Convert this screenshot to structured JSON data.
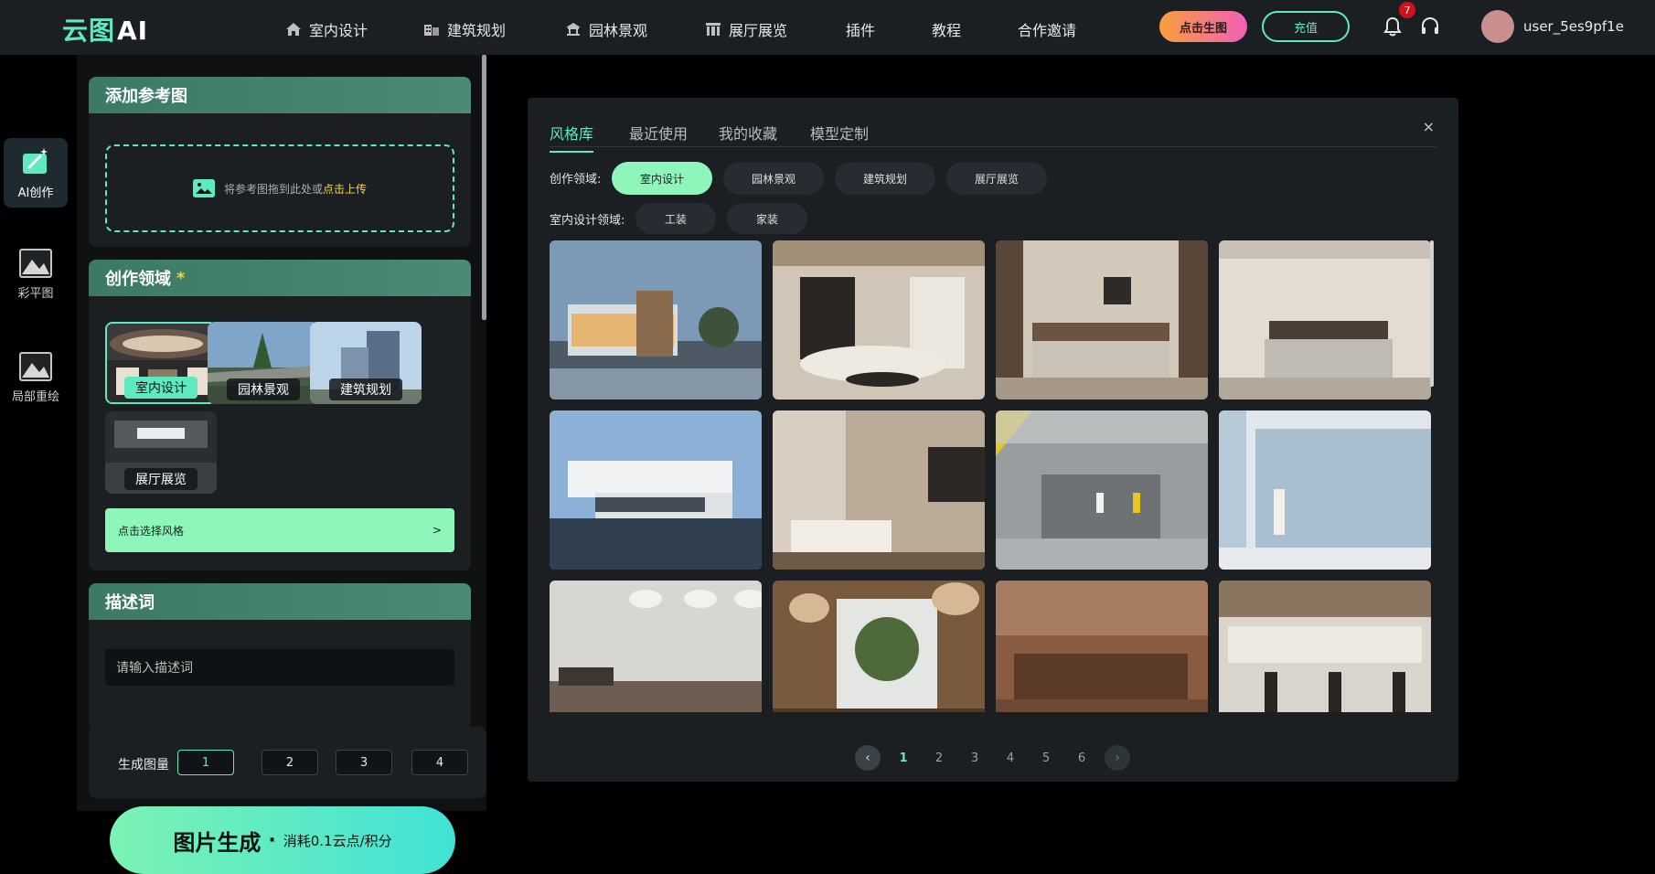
{
  "header": {
    "logo_main": "云图",
    "logo_ai": "AI",
    "nav": [
      {
        "label": "室内设计",
        "icon": "house-icon"
      },
      {
        "label": "建筑规划",
        "icon": "building-icon"
      },
      {
        "label": "园林景观",
        "icon": "pavilion-icon"
      },
      {
        "label": "展厅展览",
        "icon": "gallery-icon"
      },
      {
        "label": "插件"
      },
      {
        "label": "教程"
      },
      {
        "label": "合作邀请"
      }
    ],
    "generate_label": "点击生图",
    "recharge_label": "充值",
    "notifications_count": "7",
    "username": "user_5es9pf1e"
  },
  "rail": [
    {
      "label": "AI创作",
      "icon": "magic-wand-icon"
    },
    {
      "label": "彩平图",
      "icon": "image-icon"
    },
    {
      "label": "局部重绘",
      "icon": "image-icon"
    }
  ],
  "panel": {
    "reference": {
      "title": "添加参考图",
      "hint": "将参考图拖到此处或",
      "hint_link": "点击上传"
    },
    "domain": {
      "title": "创作领域",
      "required": "*",
      "options": [
        "室内设计",
        "园林景观",
        "建筑规划",
        "展厅展览"
      ],
      "selected": "室内设计",
      "choose_style": "点击选择风格",
      "choose_arrow": ">"
    },
    "prompt": {
      "title": "描述词",
      "placeholder": "请输入描述词"
    },
    "count": {
      "label": "生成图量",
      "options": [
        "1",
        "2",
        "3",
        "4"
      ],
      "selected": "1"
    },
    "generate": {
      "label": "图片生成",
      "dot": "·",
      "cost": "消耗0.1云点/积分"
    }
  },
  "modal": {
    "tabs": [
      "风格库",
      "最近使用",
      "我的收藏",
      "模型定制"
    ],
    "active_tab": "风格库",
    "close": "×",
    "domain_label": "创作领域:",
    "domains": [
      "室内设计",
      "园林景观",
      "建筑规划",
      "展厅展览"
    ],
    "active_domain": "室内设计",
    "sub_label": "室内设计领域:",
    "subs": [
      "工装",
      "家装"
    ],
    "pages": [
      "1",
      "2",
      "3",
      "4",
      "5",
      "6"
    ],
    "active_page": "1",
    "prev": "‹",
    "next": "›"
  },
  "colors": {
    "accent": "#5eeac0",
    "mint": "#8ef5bb",
    "panel_bg": "#1b1f22",
    "header_bg": "#1b1f23",
    "star": "#f5d042"
  }
}
